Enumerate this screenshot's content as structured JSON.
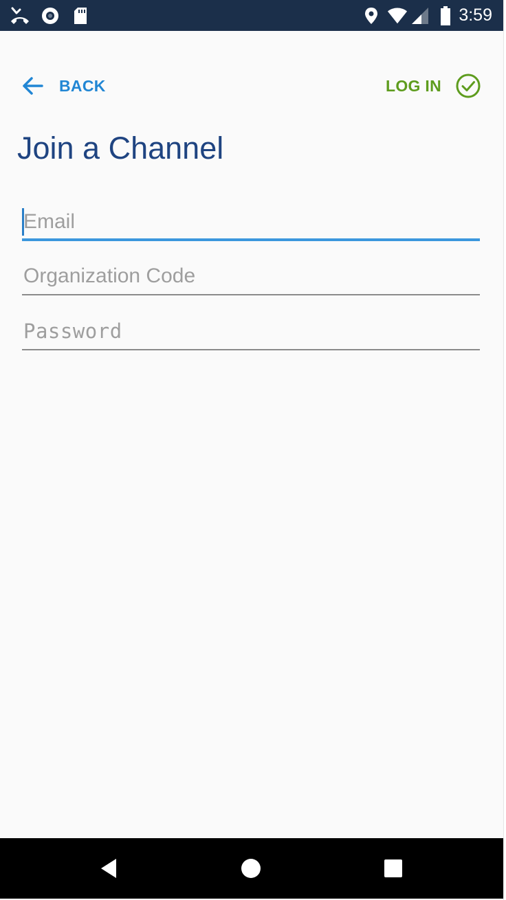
{
  "status_bar": {
    "time": "3:59",
    "left_icons": [
      "missed-call-icon",
      "record-icon",
      "sd-card-icon"
    ],
    "right_icons": [
      "location-icon",
      "wifi-icon",
      "signal-icon",
      "battery-icon"
    ]
  },
  "header": {
    "back_label": "BACK",
    "login_label": "LOG IN"
  },
  "page": {
    "title": "Join a Channel"
  },
  "form": {
    "email_placeholder": "Email",
    "email_value": "",
    "org_code_placeholder": "Organization Code",
    "org_code_value": "",
    "password_placeholder": "Password",
    "password_value": ""
  },
  "nav_bar": {
    "icons": [
      "back-triangle-icon",
      "home-circle-icon",
      "recents-square-icon"
    ]
  },
  "colors": {
    "status_bar_bg": "#1b2f4a",
    "back_blue": "#2186d4",
    "login_green": "#5e9c1e",
    "title_navy": "#1f4481",
    "focus_underline": "#3b97dd",
    "background": "#fafafa"
  }
}
